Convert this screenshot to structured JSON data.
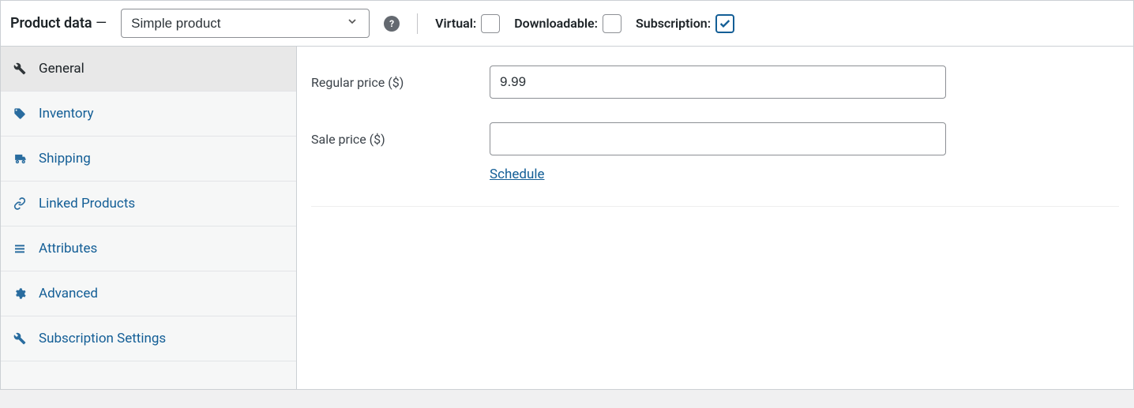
{
  "header": {
    "title": "Product data",
    "dash": "—",
    "product_type": "Simple product",
    "checkboxes": {
      "virtual": {
        "label": "Virtual:",
        "checked": false
      },
      "downloadable": {
        "label": "Downloadable:",
        "checked": false
      },
      "subscription": {
        "label": "Subscription:",
        "checked": true
      }
    }
  },
  "tabs": {
    "general": "General",
    "inventory": "Inventory",
    "shipping": "Shipping",
    "linked_products": "Linked Products",
    "attributes": "Attributes",
    "advanced": "Advanced",
    "subscription_settings": "Subscription Settings"
  },
  "form": {
    "regular_price": {
      "label": "Regular price ($)",
      "value": "9.99"
    },
    "sale_price": {
      "label": "Sale price ($)",
      "value": "",
      "schedule": "Schedule"
    }
  }
}
